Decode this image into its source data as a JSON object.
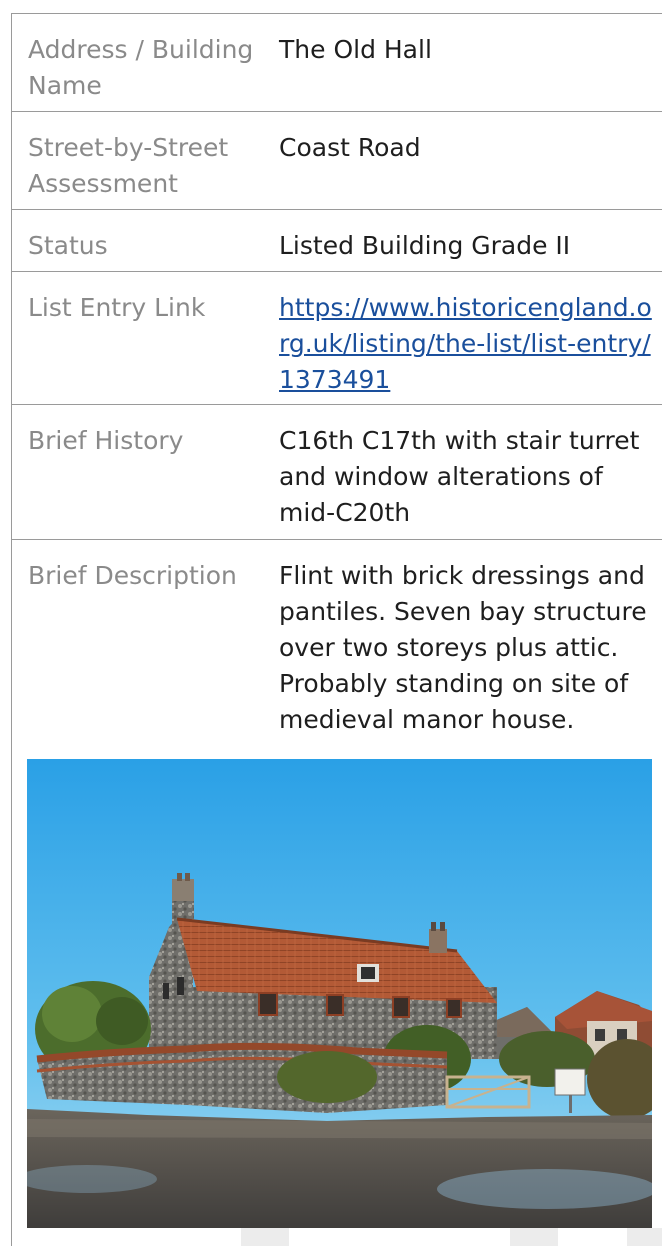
{
  "rows": [
    {
      "label": "Address / Building Name",
      "value": "The Old Hall"
    },
    {
      "label": "Street-by-Street Assessment",
      "value": "Coast Road"
    },
    {
      "label": "Status",
      "value": "Listed Building Grade II"
    },
    {
      "label": "List Entry Link",
      "value": "https://www.historicengland.org.uk/listing/the-list/list-entry/1373491"
    },
    {
      "label": "Brief History",
      "value": "C16th C17th with stair turret and window alterations of mid-C20th"
    },
    {
      "label": "Brief Description",
      "value": "Flint with brick dressings and pantiles. Seven bay structure over two storeys plus attic. Probably standing on site of medieval manor house."
    }
  ],
  "photo": {
    "subject": "flint-house-photo",
    "colors": {
      "sky": "#4fb6ec",
      "roof": "#b85a36",
      "flint": "#7d7c78",
      "brick": "#9b4a2c",
      "tree": "#4d6f2e",
      "road": "#5d5a55"
    }
  }
}
